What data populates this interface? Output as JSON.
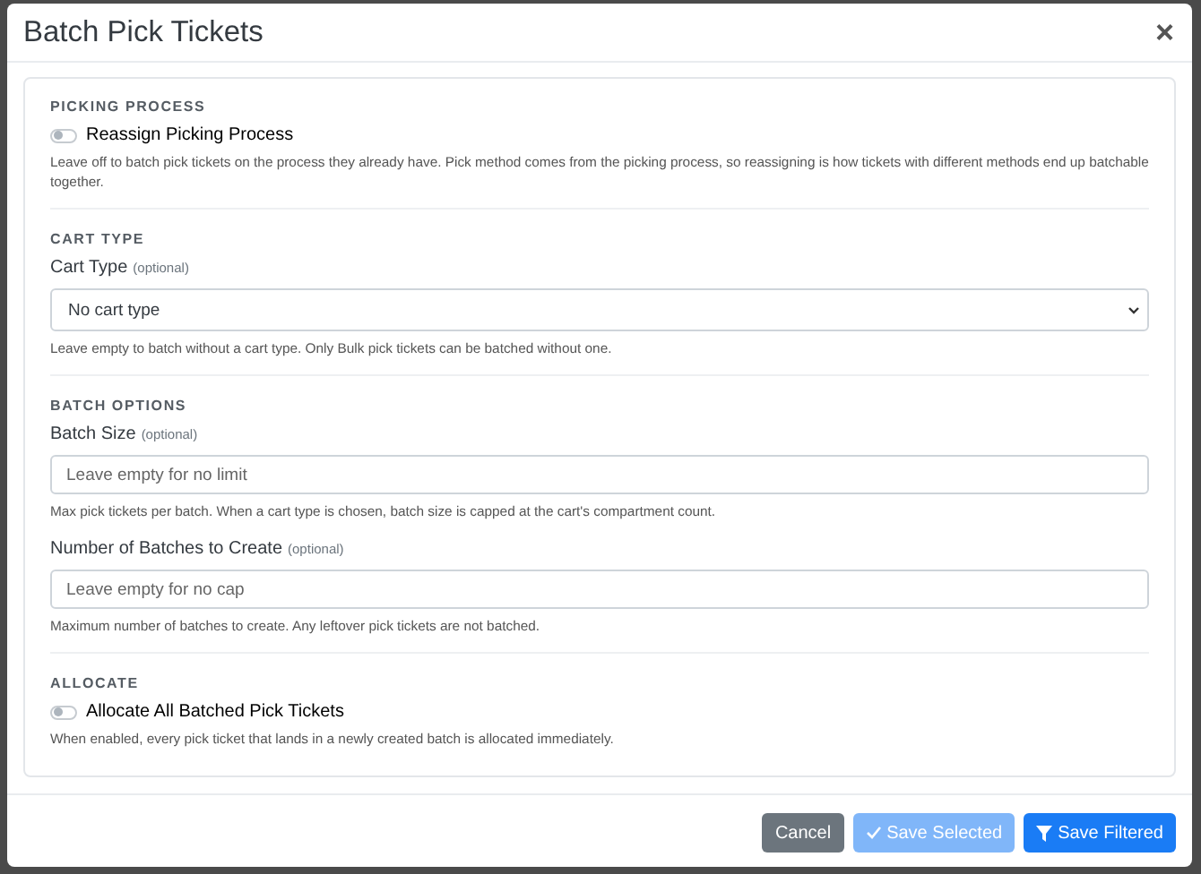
{
  "dialog": {
    "title": "Batch Pick Tickets",
    "close": "×"
  },
  "sections": [
    {
      "title": "PICKING PROCESS",
      "fields": [
        {
          "kind": "toggle",
          "label": "Reassign Picking Process",
          "on": false,
          "hint": "Leave off to batch pick tickets on the process they already have. Pick method comes from the picking process, so reassigning is how tickets with different methods end up batchable together."
        }
      ]
    },
    {
      "title": "CART TYPE",
      "fields": [
        {
          "kind": "select",
          "label": "Cart Type",
          "optional": "(optional)",
          "value": "No cart type",
          "hint": "Leave empty to batch without a cart type. Only Bulk pick tickets can be batched without one."
        }
      ]
    },
    {
      "title": "BATCH OPTIONS",
      "fields": [
        {
          "kind": "input",
          "label": "Batch Size",
          "optional": "(optional)",
          "placeholder": "Leave empty for no limit",
          "hint": "Max pick tickets per batch. When a cart type is chosen, batch size is capped at the cart's compartment count."
        },
        {
          "kind": "input",
          "label": "Number of Batches to Create",
          "optional": "(optional)",
          "placeholder": "Leave empty for no cap",
          "hint": "Maximum number of batches to create. Any leftover pick tickets are not batched."
        }
      ]
    },
    {
      "title": "ALLOCATE",
      "fields": [
        {
          "kind": "toggle",
          "label": "Allocate All Batched Pick Tickets",
          "on": false,
          "hint": "When enabled, every pick ticket that lands in a newly created batch is allocated immediately."
        }
      ]
    }
  ],
  "buttons": [
    {
      "label": "Cancel",
      "kind": "secondary",
      "disabled": false
    },
    {
      "label": "Save Selected",
      "kind": "check",
      "disabled": true
    },
    {
      "label": "Save Filtered",
      "kind": "filter",
      "disabled": false
    }
  ]
}
